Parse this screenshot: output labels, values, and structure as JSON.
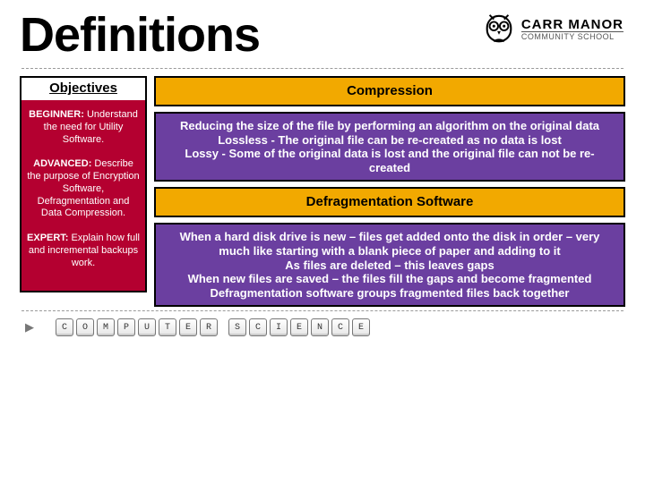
{
  "header": {
    "title": "Definitions",
    "brand_line1": "CARR MANOR",
    "brand_line2": "COMMUNITY SCHOOL"
  },
  "sidebar": {
    "title": "Objectives",
    "items": [
      {
        "label": "BEGINNER:",
        "text": "Understand the need for Utility Software."
      },
      {
        "label": "ADVANCED:",
        "text": "Describe the purpose of Encryption Software, Defragmentation and Data Compression."
      },
      {
        "label": "EXPERT:",
        "text": "Explain how full and incremental backups work."
      }
    ]
  },
  "main": {
    "section1": {
      "heading": "Compression",
      "body": "Reducing the size of the file by performing an algorithm on the original data\nLossless - The original file can be re-created as no data is lost\nLossy - Some of the original data is lost and the original file can not be re-created"
    },
    "section2": {
      "heading": "Defragmentation Software",
      "body": "When a hard disk drive is new – files get added onto the disk in order – very much like starting with a blank piece of paper and adding to it\nAs files are deleted – this leaves gaps\nWhen new files are saved – the files fill the gaps and become fragmented\nDefragmentation software groups fragmented files back together"
    }
  },
  "footer": {
    "word1": [
      "C",
      "O",
      "M",
      "P",
      "U",
      "T",
      "E",
      "R"
    ],
    "word2": [
      "S",
      "C",
      "I",
      "E",
      "N",
      "C",
      "E"
    ]
  }
}
